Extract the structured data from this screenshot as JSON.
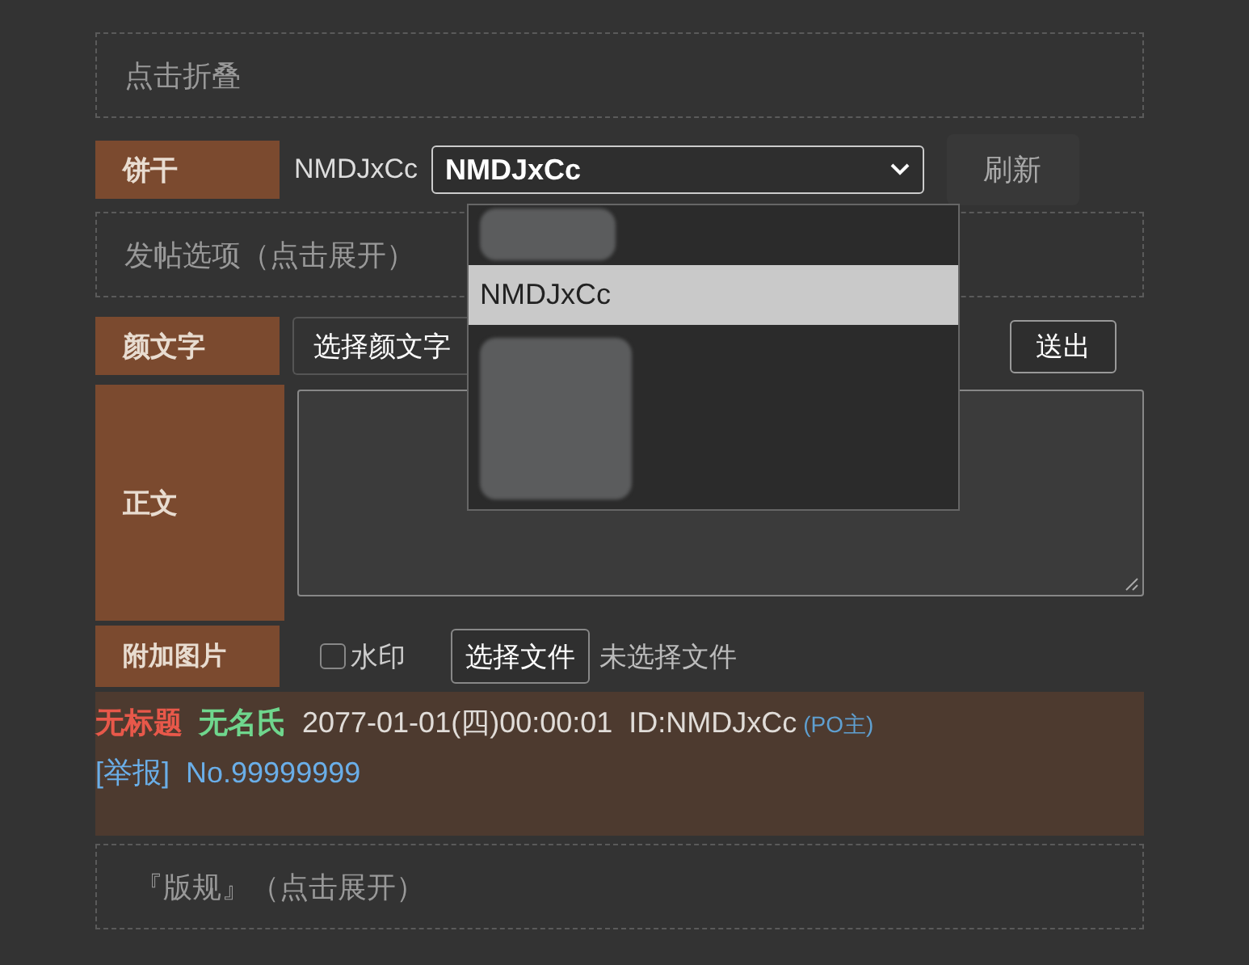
{
  "collapse_bar": {
    "label": "点击折叠"
  },
  "cookie_row": {
    "label": "饼干",
    "current": "NMDJxCc",
    "select_value": "NMDJxCc",
    "refresh_button": "刷新",
    "dropdown_options": [
      {
        "kind": "redacted",
        "selected": false
      },
      {
        "kind": "text",
        "label": "NMDJxCc",
        "selected": true
      },
      {
        "kind": "redacted",
        "selected": false
      }
    ]
  },
  "post_options": {
    "label": "发帖选项（点击展开）"
  },
  "emoticon_row": {
    "label": "颜文字",
    "select_value": "选择颜文字",
    "send_button": "送出"
  },
  "body_row": {
    "label": "正文"
  },
  "attach_row": {
    "label": "附加图片",
    "watermark": {
      "label": "水印",
      "checked": false
    },
    "file_button": "选择文件",
    "file_status": "未选择文件"
  },
  "preview": {
    "title": "无标题",
    "name": "无名氏",
    "time": "2077-01-01(四)00:00:01",
    "id": "ID:NMDJxCc",
    "po_tag": "(PO主)",
    "report_link": "[举报]",
    "number": "No.99999999"
  },
  "rules": {
    "label": "『版规』（点击展开）"
  }
}
